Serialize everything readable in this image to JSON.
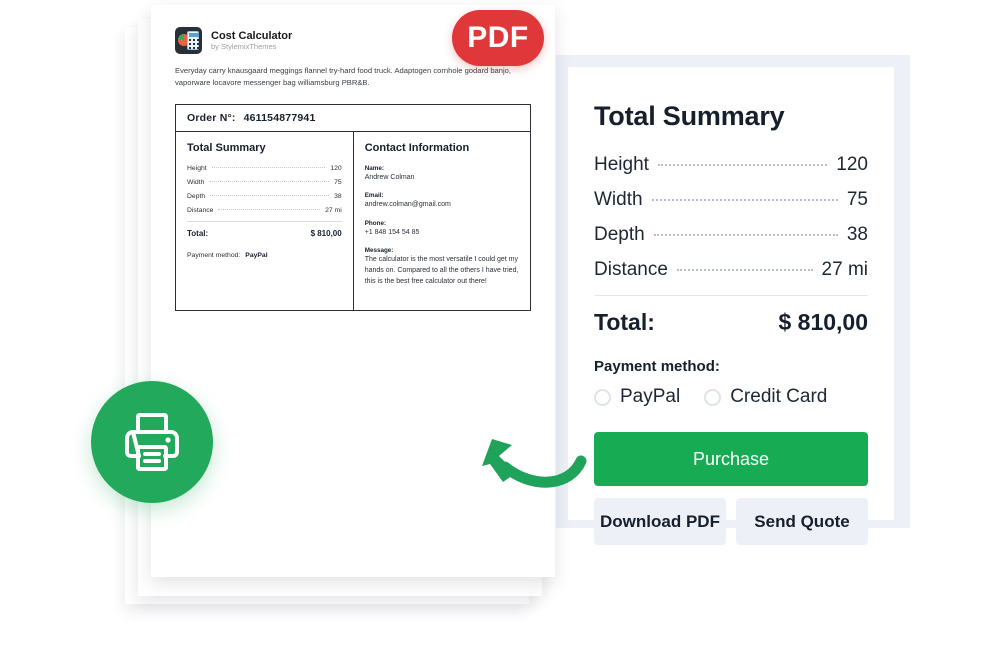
{
  "document": {
    "brand": {
      "name": "Cost Calculator",
      "subtitle": "by StylemixThemes",
      "logo_icon": "calculator-pie-logo-icon"
    },
    "badge": {
      "label": "PDF",
      "color": "#e0383a"
    },
    "description": "Everyday carry knausgaard meggings flannel try-hard food truck. Adaptogen cornhole godard banjo, vaporware locavore messenger bag williamsburg PBR&B.",
    "order": {
      "label": "Order N°:",
      "number": "461154877941"
    },
    "summary": {
      "title": "Total Summary",
      "rows": [
        {
          "label": "Height",
          "value": "120"
        },
        {
          "label": "Width",
          "value": "75"
        },
        {
          "label": "Depth",
          "value": "38"
        },
        {
          "label": "Distance",
          "value": "27 mi"
        }
      ],
      "total_label": "Total:",
      "total_value": "$ 810,00",
      "payment_label": "Payment method:",
      "payment_value": "PayPal"
    },
    "contact": {
      "title": "Contact Information",
      "name_label": "Name:",
      "name_value": "Andrew Colman",
      "email_label": "Email:",
      "email_value": "andrew.colman@gmail.com",
      "phone_label": "Phone:",
      "phone_value": "+1 848 154 54 85",
      "message_label": "Message:",
      "message_value": "The calculator is the most versatile I could get my hands on. Compared to all the others I have tried, this is the best free calculator out there!"
    }
  },
  "widget": {
    "title": "Total Summary",
    "rows": [
      {
        "label": "Height",
        "value": "120"
      },
      {
        "label": "Width",
        "value": "75"
      },
      {
        "label": "Depth",
        "value": "38"
      },
      {
        "label": "Distance",
        "value": "27 mi"
      }
    ],
    "total_label": "Total:",
    "total_value": "$ 810,00",
    "payment_label": "Payment method:",
    "payment_options": [
      {
        "label": "PayPal",
        "selected": false
      },
      {
        "label": "Credit Card",
        "selected": false
      }
    ],
    "purchase_label": "Purchase",
    "download_label": "Download PDF",
    "quote_label": "Send Quote",
    "accent_color": "#17ac53",
    "panel_color": "#eef0f7"
  },
  "decoration": {
    "print_icon": "printer-icon",
    "print_circle_color": "#23a95b",
    "arrow_icon": "curved-arrow-icon",
    "arrow_color": "#1fa35a"
  }
}
